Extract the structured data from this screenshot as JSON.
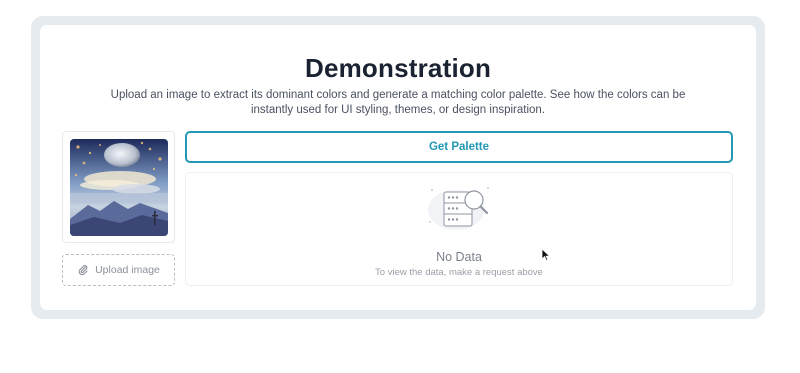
{
  "header": {
    "title": "Demonstration",
    "subtitle": "Upload an image to extract its dominant colors and generate a matching color palette. See how the colors can be instantly used for UI styling, themes, or design inspiration."
  },
  "upload": {
    "label": "Upload image",
    "icon": "paperclip-icon"
  },
  "actions": {
    "get_palette_label": "Get Palette"
  },
  "result": {
    "empty_title": "No Data",
    "empty_hint": "To view the data, make a request above",
    "icon": "server-search-icon"
  },
  "colors": {
    "accent": "#2398b5",
    "frame": "#e6ebef",
    "title": "#1b2333"
  }
}
